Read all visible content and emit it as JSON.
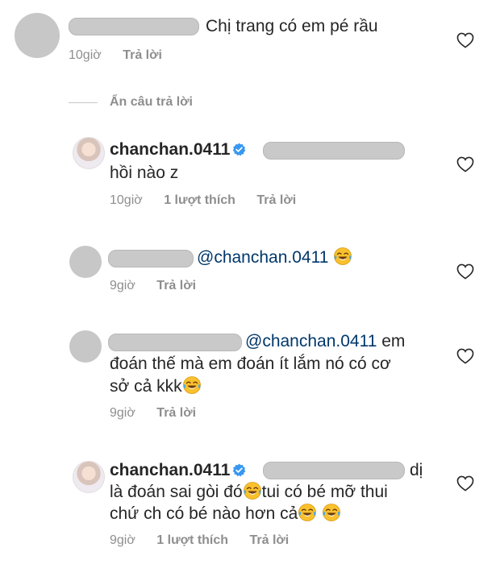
{
  "comments": [
    {
      "text": "Chị trang có em pé rầu",
      "time": "10giờ",
      "reply": "Trả lời"
    }
  ],
  "hide_replies": "Ẩn câu trả lời",
  "replies": [
    {
      "username": "chanchan.0411",
      "text": "hồi nào z",
      "time": "10giờ",
      "likes": "1 lượt thích",
      "reply": "Trả lời"
    },
    {
      "mention": "@chanchan.0411",
      "time": "9giờ",
      "reply": "Trả lời"
    },
    {
      "mention": "@chanchan.0411",
      "line1_text": "em",
      "line2": "đoán thế mà em đoán ít lắm nó có cơ",
      "line3": "sở cả kkk",
      "time": "9giờ",
      "reply": "Trả lời"
    },
    {
      "username": "chanchan.0411",
      "line1_text": "dị",
      "line2_a": "là đoán sai gòi đó",
      "line2_b": "tui có bé mỡ thui",
      "line3": "chứ ch có bé nào hơn cả",
      "time": "9giờ",
      "likes": "1 lượt thích",
      "reply": "Trả lời"
    }
  ],
  "icons": {
    "heart": "heart-outline-icon",
    "verified": "verified-badge-icon",
    "emoji": "face-with-tears-of-joy-emoji"
  },
  "colors": {
    "text": "#262626",
    "meta": "#8e8e8e",
    "mention": "#00376b",
    "verified": "#3897f0",
    "redaction": "#c9c9c9"
  }
}
